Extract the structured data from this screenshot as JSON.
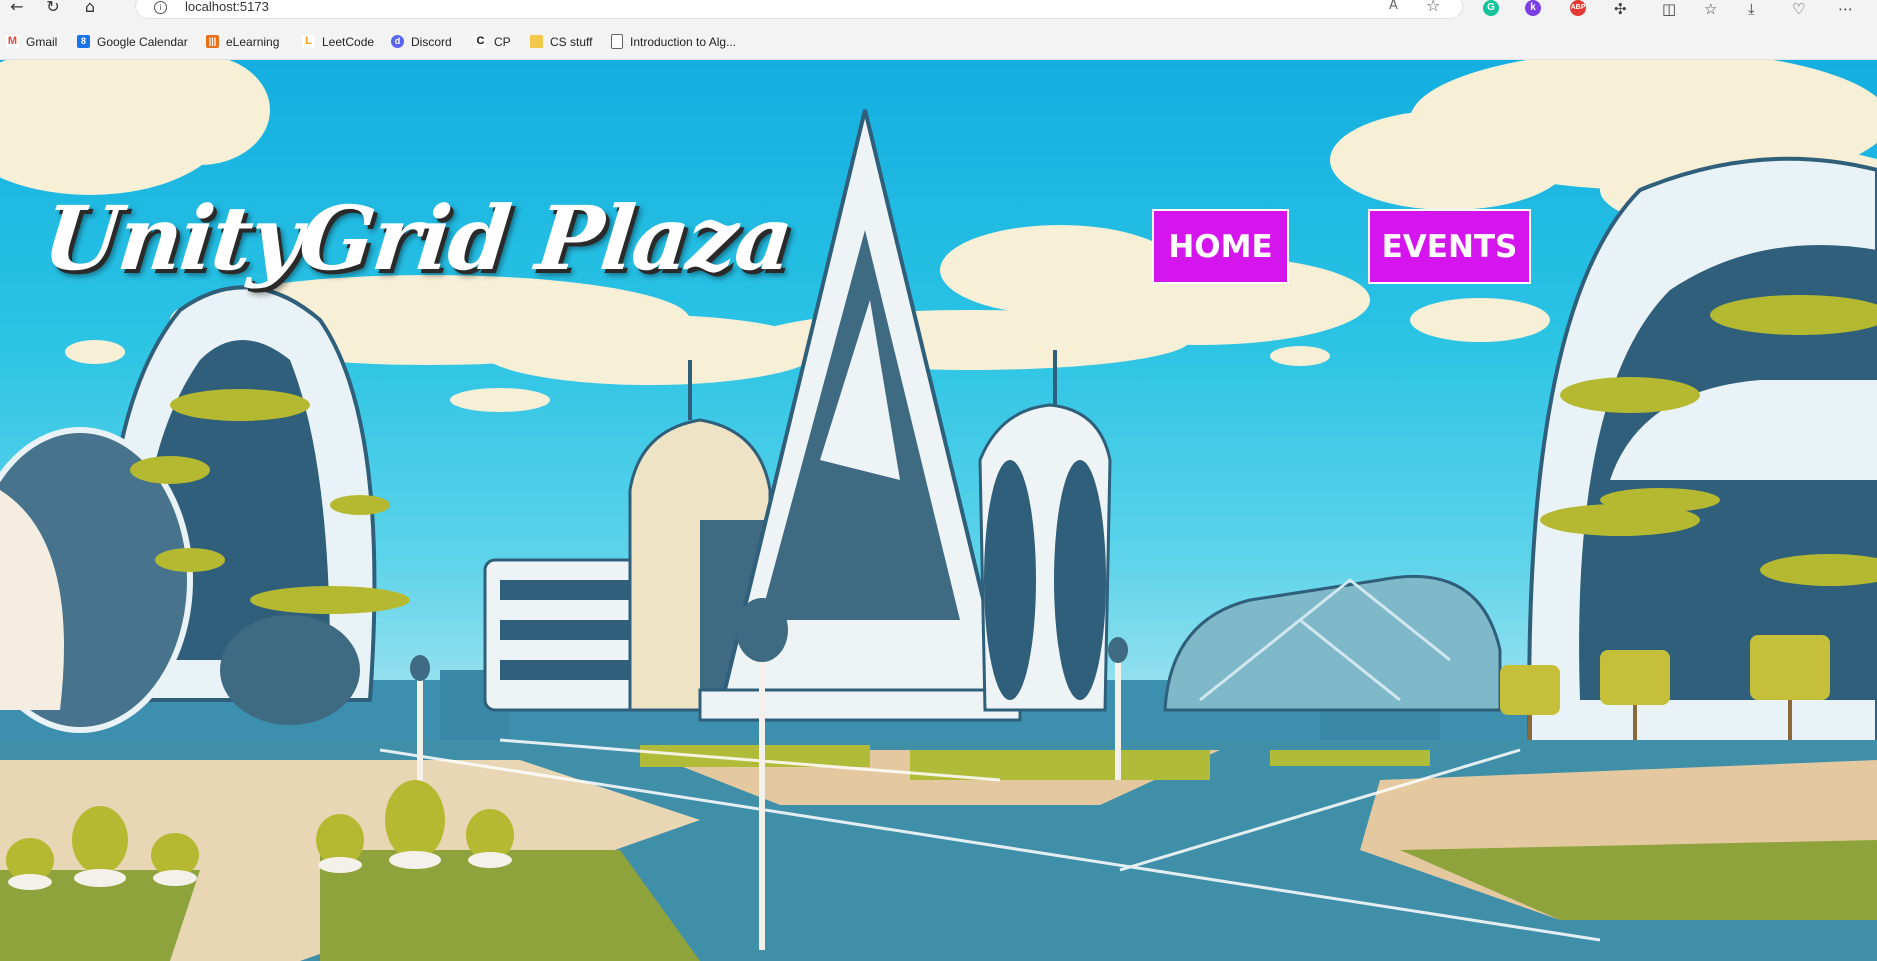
{
  "browser": {
    "url": "localhost:5173",
    "read_aloud_label": "A",
    "bookmarks": [
      {
        "label": "Gmail",
        "icon": "gmail-icon",
        "color": "#ea4335"
      },
      {
        "label": "Google Calendar",
        "icon": "calendar-icon",
        "color": "#1a73e8"
      },
      {
        "label": "eLearning",
        "icon": "elearning-icon",
        "color": "#e8711a"
      },
      {
        "label": "LeetCode",
        "icon": "leetcode-icon",
        "color": "#f89f1b"
      },
      {
        "label": "Discord",
        "icon": "discord-icon",
        "color": "#5865f2"
      },
      {
        "label": "CP",
        "icon": "cp-icon",
        "color": "#111111"
      },
      {
        "label": "CS stuff",
        "icon": "folder-icon",
        "color": "#f2c94c"
      },
      {
        "label": "Introduction to Alg...",
        "icon": "page-icon",
        "color": "#666666"
      }
    ]
  },
  "page": {
    "site_title": "UnityGrid Plaza",
    "nav": {
      "home_label": "HOME",
      "events_label": "EVENTS"
    },
    "colors": {
      "nav_button_bg": "#d515ee",
      "sky": "#14aee0"
    }
  }
}
